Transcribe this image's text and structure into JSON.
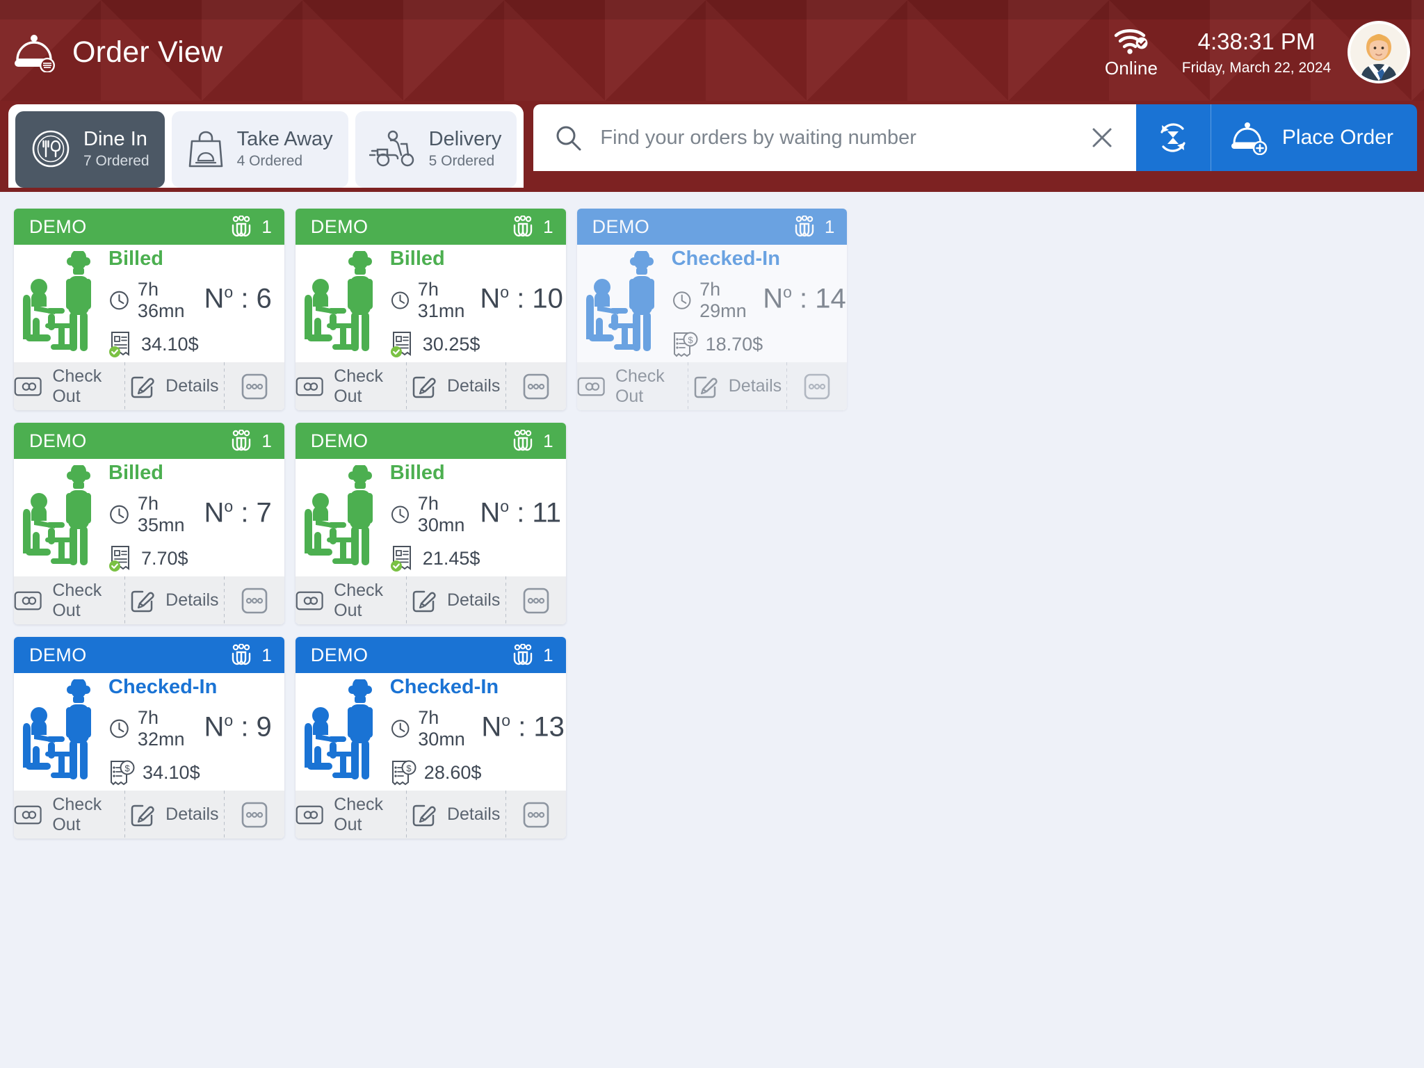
{
  "header": {
    "title": "Order View",
    "logo_icon": "cloche-icon",
    "network_icon": "wifi-check-icon",
    "network_status": "Online",
    "time": "4:38:31 PM",
    "date": "Friday, March 22, 2024",
    "avatar_icon": "user-avatar"
  },
  "tabs": [
    {
      "label": "Dine In",
      "count_label": "7 Ordered",
      "icon": "plate-cutlery-icon",
      "active": true
    },
    {
      "label": "Take Away",
      "count_label": "4 Ordered",
      "icon": "shopping-bag-icon",
      "active": false
    },
    {
      "label": "Delivery",
      "count_label": "5 Ordered",
      "icon": "scooter-delivery-icon",
      "active": false
    }
  ],
  "search": {
    "placeholder": "Find your orders by waiting number",
    "value": "",
    "search_icon": "search-icon",
    "clear_icon": "close-icon"
  },
  "actions": {
    "refresh_icon": "refresh-icon",
    "place_order_label": "Place Order",
    "place_order_icon": "cloche-plus-icon"
  },
  "colors": {
    "header_red": "#7d2222",
    "billed_green": "#4caf50",
    "checkedin_blue": "#1a73d4",
    "tab_active": "#4c5865",
    "page_bg": "#eef1f8"
  },
  "card_labels": {
    "check_out": "Check Out",
    "details": "Details",
    "more_icon": "ellipsis-box-icon",
    "check_out_icon": "checkout-card-icon",
    "details_icon": "edit-square-icon",
    "clock_icon": "clock-icon",
    "guests_icon": "guests-group-icon",
    "num_prefix": "N",
    "num_sup": "o",
    "num_sep": ":"
  },
  "orders": [
    {
      "tag": "DEMO",
      "guests": "1",
      "status": "Billed",
      "state": "billed",
      "time": "7h 36mn",
      "number": "6",
      "amount": "34.10$",
      "amount_icon": "receipt-check-icon"
    },
    {
      "tag": "DEMO",
      "guests": "1",
      "status": "Billed",
      "state": "billed",
      "time": "7h 31mn",
      "number": "10",
      "amount": "30.25$",
      "amount_icon": "receipt-check-icon"
    },
    {
      "tag": "DEMO",
      "guests": "1",
      "status": "Checked-In",
      "state": "checkedin",
      "time": "7h 29mn",
      "number": "14",
      "amount": "18.70$",
      "amount_icon": "receipt-dollar-icon"
    },
    {
      "tag": "DEMO",
      "guests": "1",
      "status": "Billed",
      "state": "billed",
      "time": "7h 35mn",
      "number": "7",
      "amount": "7.70$",
      "amount_icon": "receipt-check-icon"
    },
    {
      "tag": "DEMO",
      "guests": "1",
      "status": "Billed",
      "state": "billed",
      "time": "7h 30mn",
      "number": "11",
      "amount": "21.45$",
      "amount_icon": "receipt-check-icon"
    },
    {
      "tag": "DEMO",
      "guests": "1",
      "status": "Checked-In",
      "state": "checkedin",
      "time": "7h 32mn",
      "number": "9",
      "amount": "34.10$",
      "amount_icon": "receipt-dollar-icon"
    },
    {
      "tag": "DEMO",
      "guests": "1",
      "status": "Checked-In",
      "state": "checkedin",
      "time": "7h 30mn",
      "number": "13",
      "amount": "28.60$",
      "amount_icon": "receipt-dollar-icon"
    }
  ]
}
